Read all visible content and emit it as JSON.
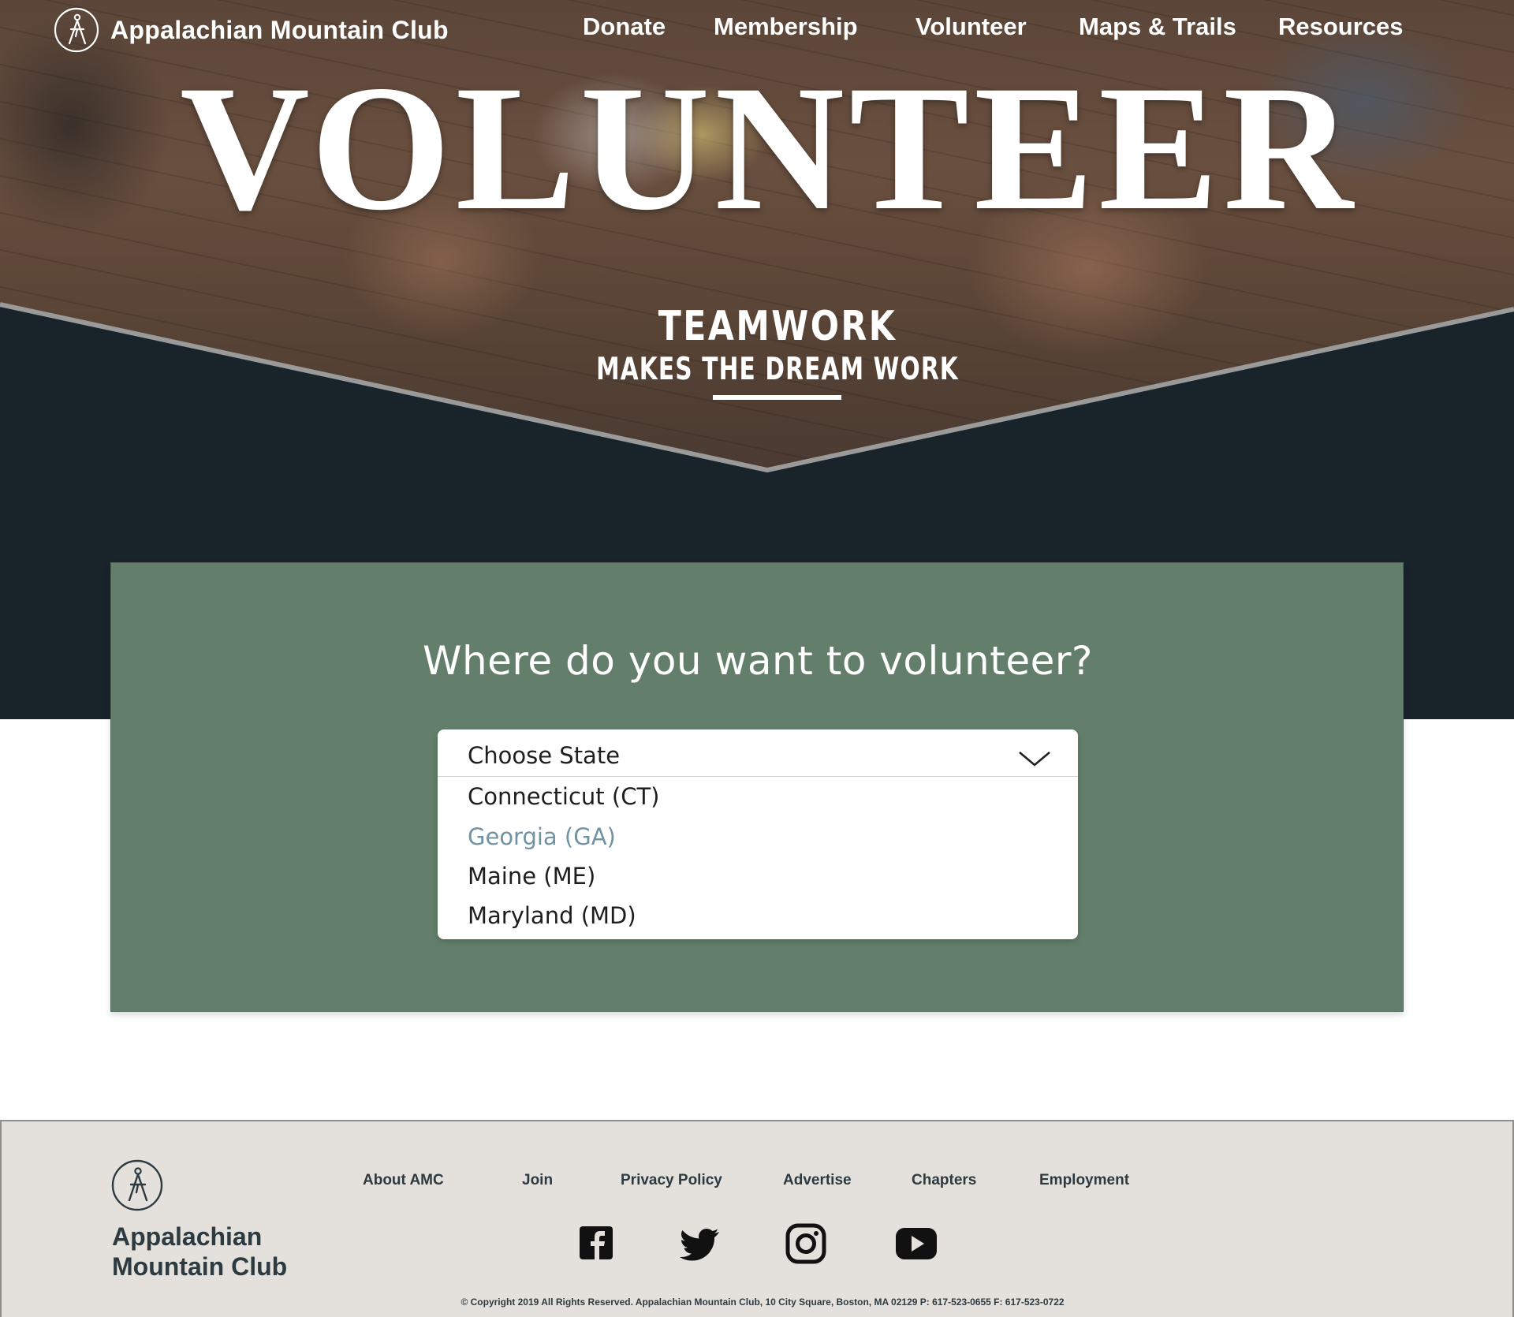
{
  "site": {
    "name": "Appalachian Mountain Club",
    "logo_icon": "amc-hiker-logo-icon"
  },
  "nav": {
    "items": [
      {
        "label": "Donate"
      },
      {
        "label": "Membership"
      },
      {
        "label": "Volunteer"
      },
      {
        "label": "Maps & Trails"
      },
      {
        "label": "Resources"
      }
    ]
  },
  "hero": {
    "title": "VOLUNTEER",
    "tagline_line1": "TEAMWORK",
    "tagline_line2": "MAKES THE DREAM WORK"
  },
  "volunteer_form": {
    "question": "Where do you want to volunteer?",
    "state_select": {
      "placeholder": "Choose State",
      "expanded": true,
      "highlighted_option": "Georgia (GA)",
      "options": [
        {
          "label": "Connecticut (CT)"
        },
        {
          "label": "Georgia (GA)"
        },
        {
          "label": "Maine (ME)"
        },
        {
          "label": "Maryland (MD)"
        }
      ]
    }
  },
  "footer": {
    "brand_line1": "Appalachian",
    "brand_line2": "Mountain Club",
    "links": [
      {
        "label": "About AMC"
      },
      {
        "label": "Join"
      },
      {
        "label": "Privacy Policy"
      },
      {
        "label": "Advertise"
      },
      {
        "label": "Chapters"
      },
      {
        "label": "Employment"
      }
    ],
    "social": [
      {
        "icon": "facebook-icon"
      },
      {
        "icon": "twitter-icon"
      },
      {
        "icon": "instagram-icon"
      },
      {
        "icon": "youtube-icon"
      }
    ],
    "copyright": "© Copyright 2019 All Rights Reserved. Appalachian Mountain Club, 10 City Square, Boston, MA 02129 P: 617-523-0655 F: 617-523-0722"
  },
  "colors": {
    "hero_dark": "#19232a",
    "panel_green": "#637f6b",
    "option_highlight": "#6f93a3",
    "footer_bg": "#e4e1dd",
    "footer_text": "#2d3a40"
  }
}
